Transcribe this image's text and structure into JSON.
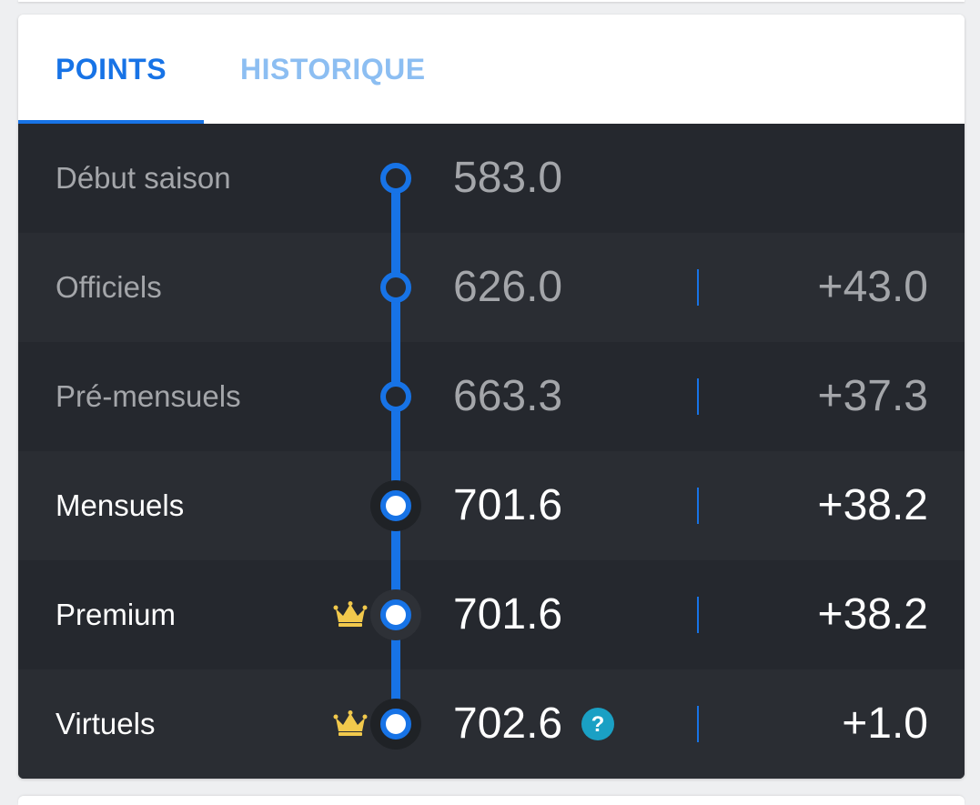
{
  "tabs": {
    "points": "POINTS",
    "historique": "HISTORIQUE"
  },
  "rows": [
    {
      "label": "Début saison",
      "value": "583.0",
      "delta": "",
      "state": "muted",
      "crown": false,
      "help": false
    },
    {
      "label": "Officiels",
      "value": "626.0",
      "delta": "+43.0",
      "state": "muted",
      "crown": false,
      "help": false
    },
    {
      "label": "Pré-mensuels",
      "value": "663.3",
      "delta": "+37.3",
      "state": "muted",
      "crown": false,
      "help": false
    },
    {
      "label": "Mensuels",
      "value": "701.6",
      "delta": "+38.2",
      "state": "active",
      "crown": false,
      "help": false
    },
    {
      "label": "Premium",
      "value": "701.6",
      "delta": "+38.2",
      "state": "active",
      "crown": true,
      "help": false
    },
    {
      "label": "Virtuels",
      "value": "702.6",
      "delta": "+1.0",
      "state": "active",
      "crown": true,
      "help": true
    }
  ],
  "icons": {
    "crown": "crown-icon",
    "help": "question-mark-icon"
  },
  "colors": {
    "accent": "#1773e6",
    "tab_inactive": "#8cbef2",
    "panel_bg": "#25282e",
    "panel_alt_bg": "#2a2d33",
    "muted_text": "#a4a6aa",
    "active_text": "#ffffff",
    "crown": "#f2c94c",
    "help_badge": "#1aa0c4"
  }
}
